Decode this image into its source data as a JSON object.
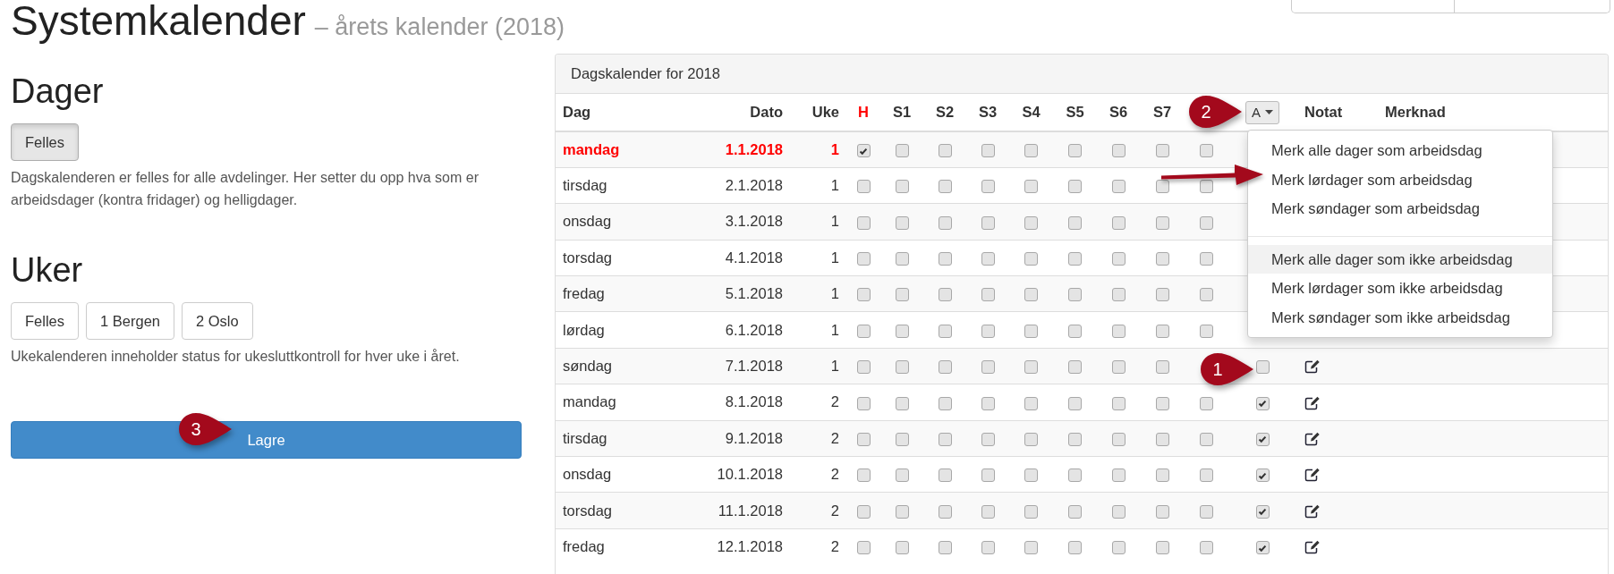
{
  "page": {
    "title": "Systemkalender",
    "subtitle": "– årets kalender (2018)"
  },
  "days": {
    "heading": "Dager",
    "buttons": [
      {
        "label": "Felles",
        "selected": true
      }
    ],
    "description": "Dagskalenderen er felles for alle avdelinger. Her setter du opp hva som er arbeidsdager (kontra fridager) og helligdager."
  },
  "weeks": {
    "heading": "Uker",
    "buttons": [
      {
        "label": "Felles",
        "selected": false
      },
      {
        "label": "1 Bergen",
        "selected": false
      },
      {
        "label": "2 Oslo",
        "selected": false
      }
    ],
    "description": "Ukekalenderen inneholder status for ukesluttkontroll for hver uke i året."
  },
  "save_button": "Lagre",
  "calendar": {
    "title": "Dagskalender for 2018",
    "columns": [
      {
        "label": "Dag",
        "kind": "text"
      },
      {
        "label": "Dato",
        "kind": "number"
      },
      {
        "label": "Uke",
        "kind": "number"
      },
      {
        "label": "H",
        "kind": "holiday"
      },
      {
        "label": "S1",
        "kind": "check"
      },
      {
        "label": "S2",
        "kind": "check"
      },
      {
        "label": "S3",
        "kind": "check"
      },
      {
        "label": "S4",
        "kind": "check"
      },
      {
        "label": "S5",
        "kind": "check"
      },
      {
        "label": "S6",
        "kind": "check"
      },
      {
        "label": "S7",
        "kind": "check"
      },
      {
        "kind": "blank"
      },
      {
        "label": "A",
        "kind": "dropdown"
      },
      {
        "label": "Notat",
        "kind": "text"
      },
      {
        "label": "Merknad",
        "kind": "text"
      }
    ],
    "rows": [
      {
        "day": "mandag",
        "date": "1.1.2018",
        "week": "1",
        "holiday": true,
        "checks": [
          false,
          false,
          false,
          false,
          false,
          false,
          false
        ],
        "column_12": false
      },
      {
        "day": "tirsdag",
        "date": "2.1.2018",
        "week": "1",
        "holiday": false,
        "checks": [
          false,
          false,
          false,
          false,
          false,
          false,
          false
        ],
        "column_12": false
      },
      {
        "day": "onsdag",
        "date": "3.1.2018",
        "week": "1",
        "holiday": false,
        "checks": [
          false,
          false,
          false,
          false,
          false,
          false,
          false
        ],
        "column_12": false
      },
      {
        "day": "torsdag",
        "date": "4.1.2018",
        "week": "1",
        "holiday": false,
        "checks": [
          false,
          false,
          false,
          false,
          false,
          false,
          false
        ],
        "column_12": false
      },
      {
        "day": "fredag",
        "date": "5.1.2018",
        "week": "1",
        "holiday": false,
        "checks": [
          false,
          false,
          false,
          false,
          false,
          false,
          false
        ],
        "column_12": false
      },
      {
        "day": "lørdag",
        "date": "6.1.2018",
        "week": "1",
        "holiday": false,
        "checks": [
          false,
          false,
          false,
          false,
          false,
          false,
          false
        ],
        "column_12": false
      },
      {
        "day": "søndag",
        "date": "7.1.2018",
        "week": "1",
        "holiday": false,
        "checks": [
          false,
          false,
          false,
          false,
          false,
          false,
          false
        ],
        "workday": false,
        "note_icon": true
      },
      {
        "day": "mandag",
        "date": "8.1.2018",
        "week": "2",
        "holiday": false,
        "checks": [
          false,
          false,
          false,
          false,
          false,
          false,
          false
        ],
        "column_12": false,
        "workday": true,
        "note_icon": true
      },
      {
        "day": "tirsdag",
        "date": "9.1.2018",
        "week": "2",
        "holiday": false,
        "checks": [
          false,
          false,
          false,
          false,
          false,
          false,
          false
        ],
        "column_12": false,
        "workday": true,
        "note_icon": true
      },
      {
        "day": "onsdag",
        "date": "10.1.2018",
        "week": "2",
        "holiday": false,
        "checks": [
          false,
          false,
          false,
          false,
          false,
          false,
          false
        ],
        "column_12": false,
        "workday": true,
        "note_icon": true
      },
      {
        "day": "torsdag",
        "date": "11.1.2018",
        "week": "2",
        "holiday": false,
        "checks": [
          false,
          false,
          false,
          false,
          false,
          false,
          false
        ],
        "column_12": false,
        "workday": true,
        "note_icon": true
      },
      {
        "day": "fredag",
        "date": "12.1.2018",
        "week": "2",
        "holiday": false,
        "checks": [
          false,
          false,
          false,
          false,
          false,
          false,
          false
        ],
        "column_12": false,
        "workday": true,
        "note_icon": true
      }
    ],
    "dropdown": {
      "items": [
        {
          "kind": "item",
          "label": "Merk alle dager som arbeidsdag",
          "highlighted": false
        },
        {
          "kind": "item",
          "label": "Merk lørdager som arbeidsdag",
          "highlighted": false
        },
        {
          "kind": "item",
          "label": "Merk søndager som arbeidsdag",
          "highlighted": false
        },
        {
          "kind": "divider"
        },
        {
          "kind": "item",
          "label": "Merk alle dager som ikke arbeidsdag",
          "highlighted": true
        },
        {
          "kind": "item",
          "label": "Merk lørdager som ikke arbeidsdag",
          "highlighted": false
        },
        {
          "kind": "item",
          "label": "Merk søndager som ikke arbeidsdag",
          "highlighted": false
        }
      ]
    }
  },
  "callouts": [
    {
      "number": "2"
    },
    {
      "number": "1"
    },
    {
      "number": "3"
    }
  ]
}
